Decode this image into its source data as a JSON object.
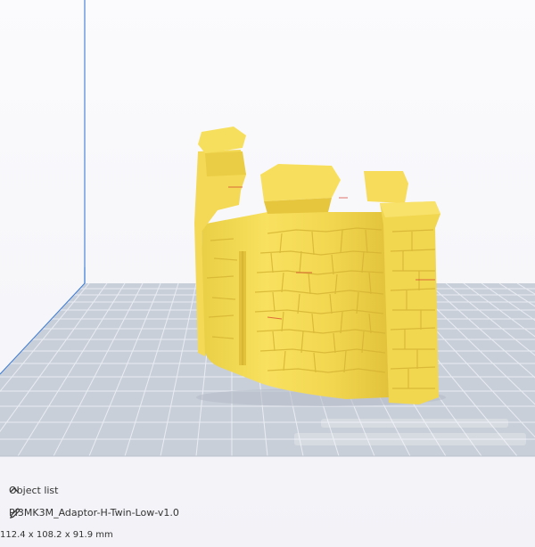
{
  "object_list": {
    "header_label": "Object list",
    "file_name": "PI3MK3M_Adaptor-H-Twin-Low-v1.0",
    "dimensions": "112.4 x 108.2 x 91.9 mm"
  },
  "colors": {
    "model": "#f8e266",
    "model_shade": "#e8c93c",
    "build_plate": "#c9cfd9",
    "grid_line": "#eef0f5",
    "axis_blue": "#3b7bd6"
  },
  "icons": {
    "collapse": "chevron-up-icon",
    "edit": "pencil-icon"
  }
}
